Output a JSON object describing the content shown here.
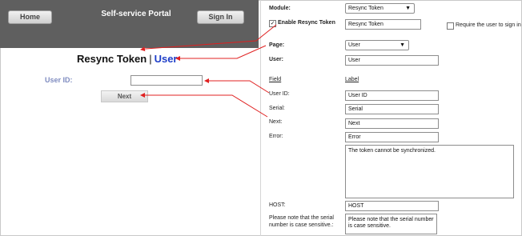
{
  "preview": {
    "home_label": "Home",
    "portal_title": "Self-service Portal",
    "sign_in_label": "Sign In",
    "title_main": "Resync Token",
    "title_sep": "|",
    "title_user": "User",
    "userid_label": "User ID:",
    "next_label": "Next"
  },
  "config": {
    "module_label": "Module:",
    "module_value": "Resync Token",
    "enable_label": "Enable Resync Token",
    "enable_checked": true,
    "enable_value": "Resync Token",
    "require_signin_label": "Require the user to sign in",
    "page_label": "Page:",
    "page_value": "User",
    "user_label": "User:",
    "user_value": "User",
    "field_header": "Field",
    "label_header": "Label",
    "userid_label": "User ID:",
    "userid_value": "User ID",
    "serial_label": "Serial:",
    "serial_value": "Serial",
    "next_label": "Next:",
    "next_value": "Next",
    "error_label": "Error:",
    "error_value": "Error",
    "error_message": "The token cannot be synchronized.",
    "host_label": "HOST:",
    "host_value": "HOST",
    "note_label": "Please note that the serial number is case sensitive.:",
    "note_value": "Please note that the serial number is case sensitive."
  },
  "colors": {
    "header_bg": "#5f5f5f",
    "title_user": "#1e3ec8",
    "userid_label": "#7f8cc0",
    "arrow": "#e02020"
  }
}
